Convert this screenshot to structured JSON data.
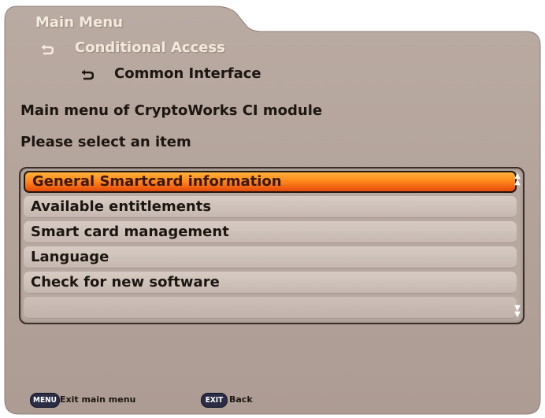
{
  "breadcrumb": {
    "level1": "Main Menu",
    "level2": "Conditional Access",
    "level3": "Common Interface"
  },
  "info": {
    "line1": "Main menu of CryptoWorks CI module",
    "line2": "Please select an item"
  },
  "menu": {
    "items": [
      {
        "label": "General Smartcard information",
        "selected": true
      },
      {
        "label": "Available entitlements",
        "selected": false
      },
      {
        "label": "Smart card management",
        "selected": false
      },
      {
        "label": "Language",
        "selected": false
      },
      {
        "label": "Check for new software",
        "selected": false
      }
    ]
  },
  "footer": {
    "menu_key": "MENU",
    "menu_label": "Exit main menu",
    "exit_key": "EXIT",
    "exit_label": "Back"
  },
  "colors": {
    "panel": "#b3a39b",
    "highlight": "#ff8a1c",
    "key_button": "#2b2c45"
  }
}
